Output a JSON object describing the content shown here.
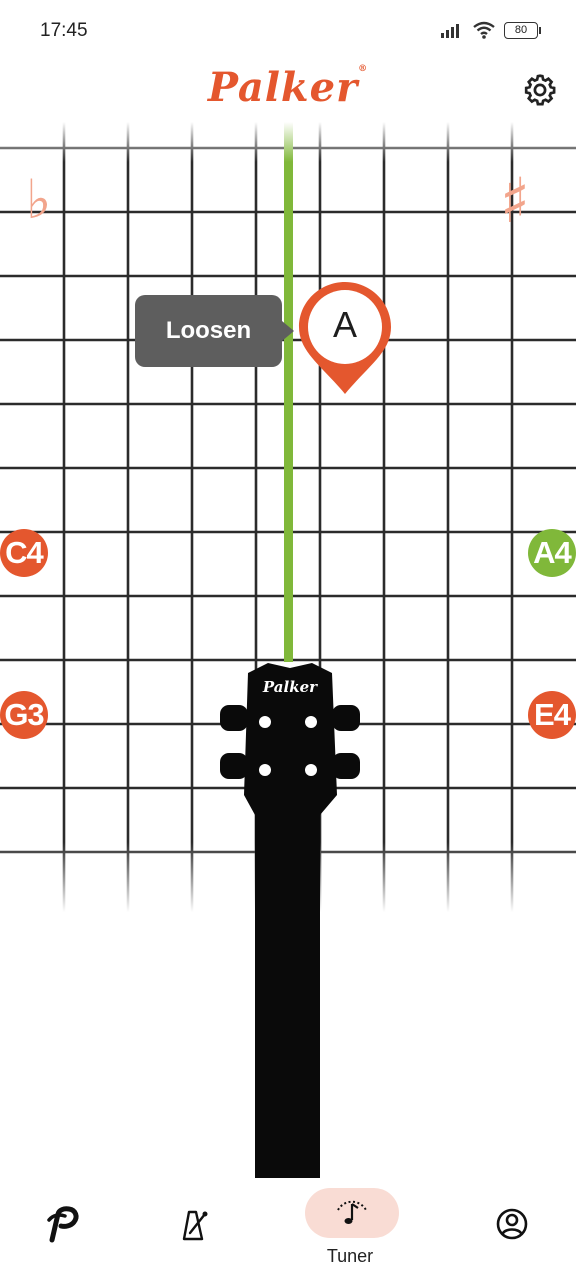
{
  "status_bar": {
    "time": "17:45",
    "battery_level": "80",
    "icons": [
      "signal-icon",
      "wifi-icon",
      "battery-icon"
    ]
  },
  "header": {
    "logo_text": "Palker",
    "logo_mark": "®",
    "settings_icon": "gear-icon"
  },
  "tuner": {
    "flat_symbol": "♭",
    "sharp_symbol": "♯",
    "instruction": "Loosen",
    "detected_note": "A",
    "strings": {
      "left_upper": "C4",
      "left_lower": "G3",
      "right_upper": "A4",
      "right_lower": "E4"
    },
    "active_string": "A4",
    "headstock_brand": "Palker"
  },
  "colors": {
    "accent": "#e4572e",
    "in_tune": "#80b83a",
    "tooltip_bg": "#5e5e5e",
    "nav_active_bg": "#f9dcd4"
  },
  "bottom_nav": {
    "items": [
      {
        "icon": "palker-logo-icon",
        "label": ""
      },
      {
        "icon": "metronome-icon",
        "label": ""
      },
      {
        "icon": "tuner-icon",
        "label": "Tuner",
        "active": true
      },
      {
        "icon": "profile-icon",
        "label": ""
      }
    ]
  }
}
